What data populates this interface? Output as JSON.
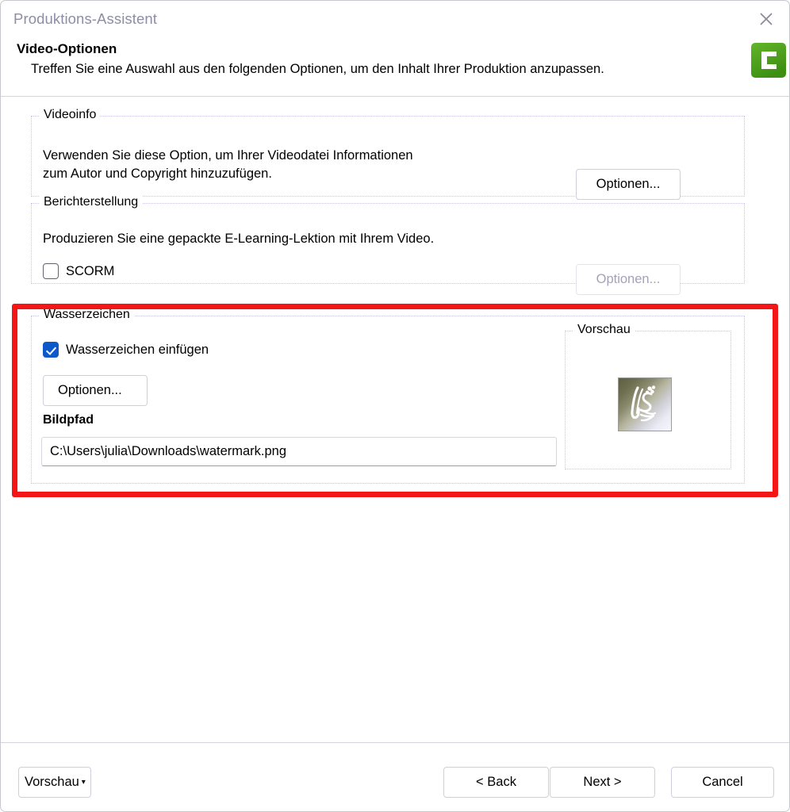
{
  "window": {
    "title": "Produktions-Assistent",
    "close_icon": "close-icon"
  },
  "header": {
    "title": "Video-Optionen",
    "subtitle": "Treffen Sie eine Auswahl aus den folgenden Optionen, um den Inhalt Ihrer Produktion anzupassen.",
    "brand_icon": "camtasia-logo-icon",
    "brand_color": "#4CA222"
  },
  "sections": {
    "videoinfo": {
      "legend": "Videoinfo",
      "description": "Verwenden Sie diese Option, um Ihrer Videodatei Informationen\nzum Autor und Copyright hinzuzufügen.",
      "options_button": "Optionen...",
      "options_enabled": true
    },
    "berichterstellung": {
      "legend": "Berichterstellung",
      "description": "Produzieren Sie eine gepackte E-Learning-Lektion mit Ihrem Video.",
      "scorm_label": "SCORM",
      "scorm_checked": false,
      "options_button": "Optionen...",
      "options_enabled": false
    },
    "wasserzeichen": {
      "legend": "Wasserzeichen",
      "insert_label": "Wasserzeichen einfügen",
      "insert_checked": true,
      "options_button": "Optionen...",
      "image_path_label": "Bildpfad",
      "image_path_value": "C:\\Users\\julia\\Downloads\\watermark.png",
      "image_path_placeholder": "Bildpfad auswählen",
      "highlight_color": "#F41616"
    },
    "vorschau": {
      "legend": "Vorschau",
      "thumbnail_icon": "watermark-monogram-thumbnail"
    }
  },
  "footer": {
    "preview_button": "Vorschau",
    "preview_caret": "▾",
    "back_button": "< Back",
    "next_button": "Next >",
    "cancel_button": "Cancel"
  }
}
